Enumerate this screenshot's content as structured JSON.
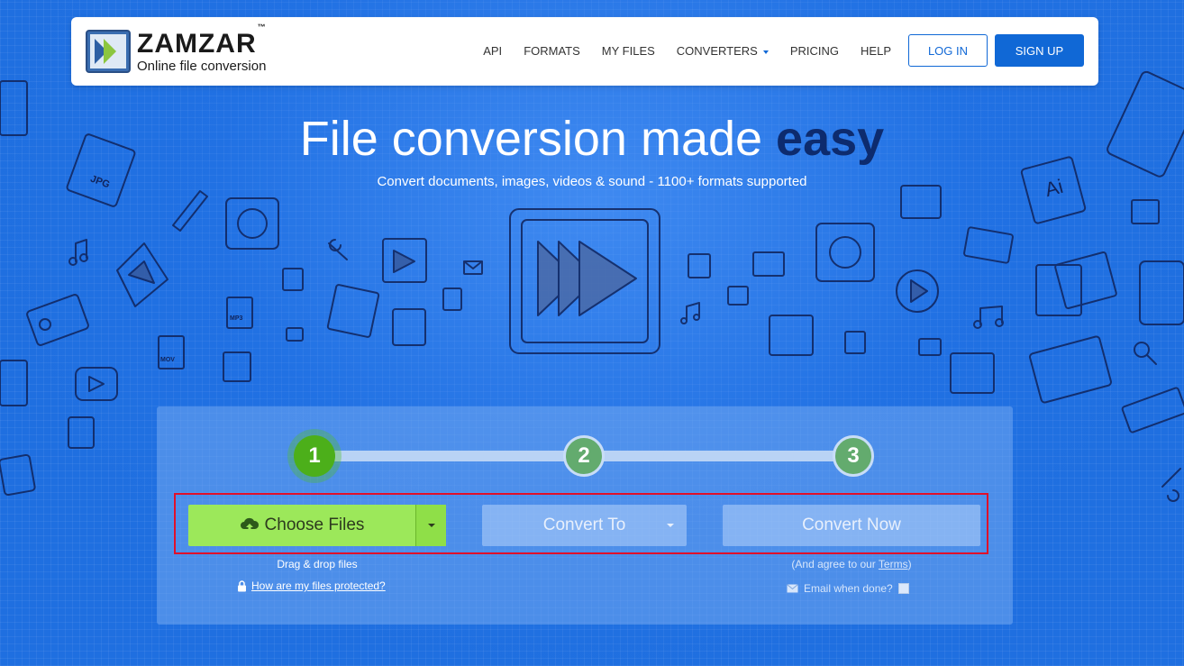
{
  "brand": {
    "name": "ZAMZAR",
    "trademark": "™",
    "tagline": "Online file conversion"
  },
  "nav": {
    "items": [
      "API",
      "FORMATS",
      "MY FILES",
      "CONVERTERS",
      "PRICING",
      "HELP"
    ],
    "login_label": "LOG IN",
    "signup_label": "SIGN UP"
  },
  "hero": {
    "title_main": "File conversion made ",
    "title_emph": "easy",
    "subtitle": "Convert documents, images, videos & sound - 1100+ formats supported"
  },
  "steps": [
    "1",
    "2",
    "3"
  ],
  "converter": {
    "choose_label": "Choose Files",
    "convert_to_label": "Convert To",
    "convert_now_label": "Convert Now",
    "drag_text": "Drag & drop files",
    "protected_link": "How are my files protected?",
    "terms_prefix": "(And agree to our ",
    "terms_link": "Terms",
    "terms_suffix": ")",
    "email_label": "Email when done?"
  },
  "deco_labels": {
    "jpg": "JPG",
    "mp3": "MP3",
    "mov": "MOV",
    "ai": "Ai"
  },
  "colors": {
    "brand_blue": "#1068d6",
    "choose_green": "#9ce85a",
    "step_active": "#4caf1a",
    "highlight_red": "#e0102a"
  }
}
